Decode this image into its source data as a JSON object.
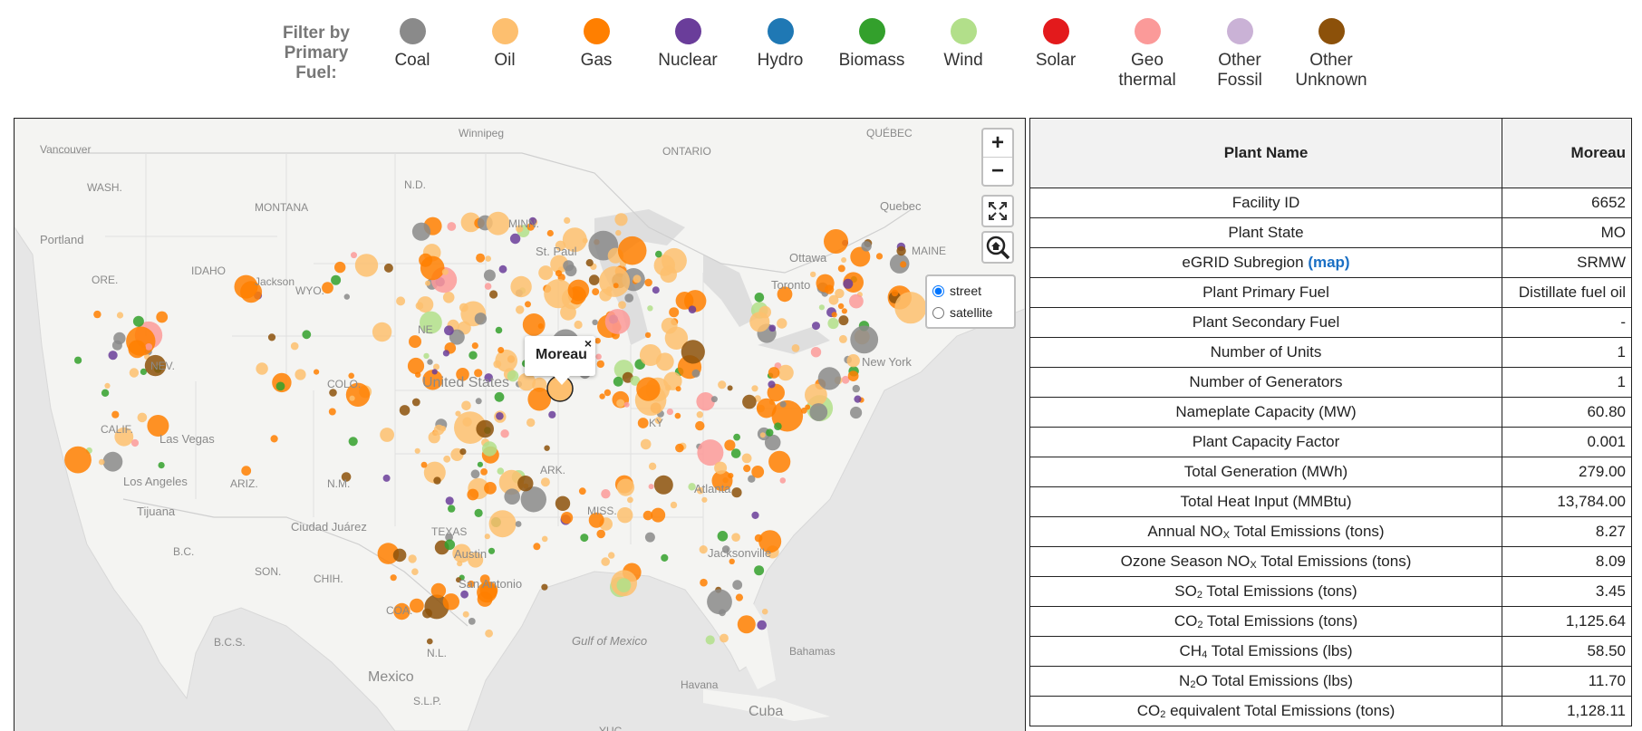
{
  "legend": {
    "title": "Filter by Primary Fuel:",
    "items": [
      {
        "label": "Coal",
        "color": "#8a8a8a"
      },
      {
        "label": "Oil",
        "color": "#fdbf6f"
      },
      {
        "label": "Gas",
        "color": "#ff7f00"
      },
      {
        "label": "Nuclear",
        "color": "#6a3d9a"
      },
      {
        "label": "Hydro",
        "color": "#1f78b4"
      },
      {
        "label": "Biomass",
        "color": "#33a02c"
      },
      {
        "label": "Wind",
        "color": "#b2df8a"
      },
      {
        "label": "Solar",
        "color": "#e31a1c"
      },
      {
        "label": "Geo thermal",
        "color": "#fb9a99"
      },
      {
        "label": "Other Fossil",
        "color": "#cab2d6"
      },
      {
        "label": "Other Unknown",
        "color": "#8c510a"
      }
    ]
  },
  "map": {
    "zoom_in": "+",
    "zoom_out": "−",
    "layers": {
      "street": "street",
      "satellite": "satellite",
      "selected": "street"
    },
    "popup": {
      "title": "Moreau",
      "close": "×"
    },
    "place_labels": [
      "Vancouver",
      "WASH.",
      "MONTANA",
      "Portland",
      "IDAHO",
      "ORE.",
      "Jackson",
      "WYO.",
      "NEV.",
      "COLO.",
      "CALIF.",
      "Las Vegas",
      "ARIZ.",
      "N.M.",
      "Los Angeles",
      "Tijuana",
      "Ciudad Juárez",
      "B.C.",
      "SON.",
      "CHIH.",
      "TEXAS",
      "Austin",
      "San Antonio",
      "COA.",
      "N.L.",
      "Mexico",
      "S.L.P.",
      "Havana",
      "Cuba",
      "YUC.",
      "Gulf of Mexico",
      "Bahamas",
      "Jacksonville",
      "Winnipeg",
      "ONTARIO",
      "QUÉBEC",
      "Quebec",
      "Ottawa",
      "Toronto",
      "MAINE",
      "New York",
      "United States",
      "N.D.",
      "MINN.",
      "KY",
      "ARK.",
      "MISS.",
      "St. Paul",
      "B.C.S.",
      "NE",
      "Atlanta"
    ]
  },
  "table": {
    "header": {
      "label": "Plant Name",
      "value": "Moreau"
    },
    "map_link": "(map)",
    "rows": [
      {
        "label": "Facility ID",
        "value": "6652"
      },
      {
        "label": "Plant State",
        "value": "MO"
      },
      {
        "label": "eGRID Subregion",
        "value": "SRMW"
      },
      {
        "label": "Plant Primary Fuel",
        "value": "Distillate fuel oil"
      },
      {
        "label": "Plant Secondary Fuel",
        "value": "-"
      },
      {
        "label": "Number of Units",
        "value": "1"
      },
      {
        "label": "Number of Generators",
        "value": "1"
      },
      {
        "label": "Nameplate Capacity (MW)",
        "value": "60.80"
      },
      {
        "label": "Plant Capacity Factor",
        "value": "0.001"
      },
      {
        "label": "Total Generation (MWh)",
        "value": "279.00"
      },
      {
        "label": "Total Heat Input (MMBtu)",
        "value": "13,784.00"
      },
      {
        "label_a": "Annual NO",
        "label_sub": "X",
        "label_b": " Total Emissions (tons)",
        "value": "8.27"
      },
      {
        "label_a": "Ozone Season NO",
        "label_sub": "X",
        "label_b": " Total Emissions (tons)",
        "value": "8.09"
      },
      {
        "label_a": "SO",
        "label_sub": "2",
        "label_b": " Total Emissions (tons)",
        "value": "3.45"
      },
      {
        "label_a": "CO",
        "label_sub": "2",
        "label_b": " Total Emissions (tons)",
        "value": "1,125.64"
      },
      {
        "label_a": "CH",
        "label_sub": "4",
        "label_b": " Total Emissions (lbs)",
        "value": "58.50"
      },
      {
        "label_a": "N",
        "label_sub": "2",
        "label_b": "O Total Emissions (lbs)",
        "value": "11.70"
      },
      {
        "label_a": "CO",
        "label_sub": "2",
        "label_b": " equivalent Total Emissions (tons)",
        "value": "1,128.11"
      }
    ]
  }
}
